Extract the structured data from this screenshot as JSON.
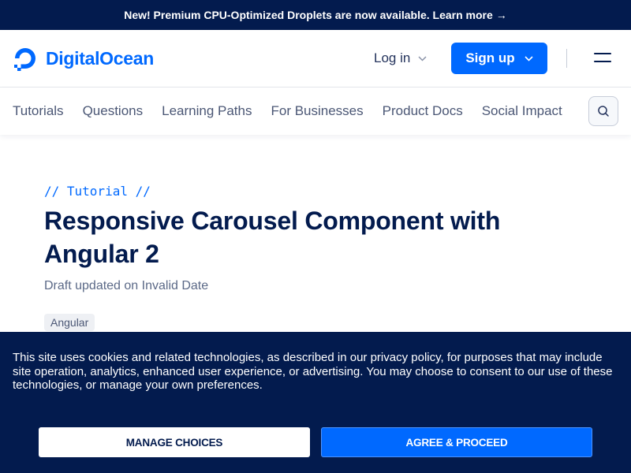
{
  "promo": {
    "text": "New! Premium CPU-Optimized Droplets are now available. Learn more",
    "arrow": "→"
  },
  "header": {
    "logo_text": "DigitalOcean",
    "login_label": "Log in",
    "signup_label": "Sign up",
    "chevron": "⌄"
  },
  "nav": {
    "items": [
      "Tutorials",
      "Questions",
      "Learning Paths",
      "For Businesses",
      "Product Docs",
      "Social Impact"
    ]
  },
  "article": {
    "eyebrow": "// Tutorial //",
    "title": "Responsive Carousel Component with Angular 2",
    "meta": "Draft updated on Invalid Date",
    "tag": "Angular"
  },
  "cookie": {
    "text": "This site uses cookies and related technologies, as described in our privacy policy, for purposes that may include site operation, analytics, enhanced user experience, or advertising. You may choose to consent to our use of these technologies, or manage your own preferences.",
    "manage_label": "MANAGE CHOICES",
    "agree_label": "AGREE & PROCEED"
  },
  "colors": {
    "navy": "#031b4e",
    "brand_blue": "#0069ff"
  },
  "icons": [
    "digitalocean-logo-icon",
    "chevron-down-icon",
    "hamburger-menu-icon",
    "search-icon",
    "arrow-right-icon"
  ]
}
